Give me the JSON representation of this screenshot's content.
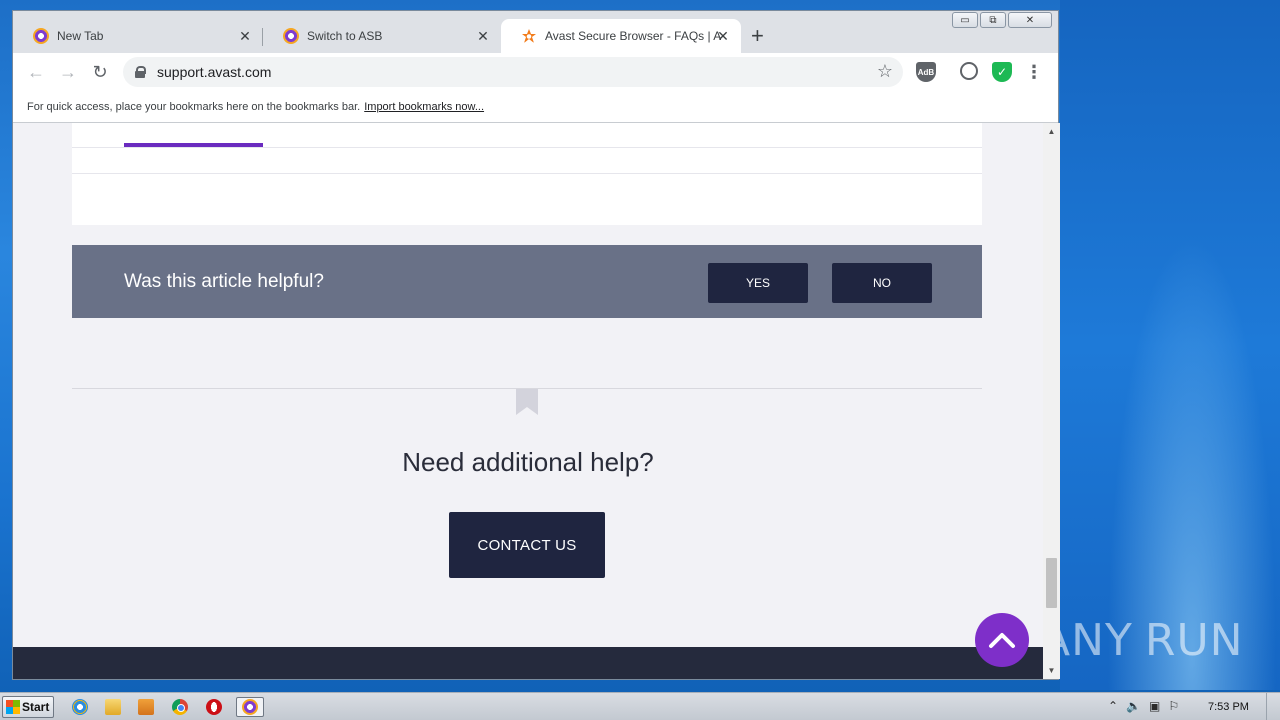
{
  "browser": {
    "tabs": [
      {
        "title": "New Tab",
        "close": "✕",
        "active": false
      },
      {
        "title": "Switch to ASB",
        "close": "✕",
        "active": false
      },
      {
        "title": "Avast Secure Browser - FAQs | Avast",
        "close": "✕",
        "active": true
      }
    ],
    "new_tab": "+",
    "url": "support.avast.com",
    "nav": {
      "back": "←",
      "forward": "→",
      "reload": "↻"
    },
    "star": "☆",
    "ext_shield_label": "AdB",
    "menu": "⋮",
    "bookmarks_bar": {
      "text": "For quick access, place your bookmarks here on the bookmarks bar.",
      "link": "Import bookmarks now..."
    },
    "window_controls": {
      "minimize": "▭",
      "restore": "⧉",
      "close": "✕"
    }
  },
  "page": {
    "helpful": {
      "question": "Was this article helpful?",
      "yes": "YES",
      "no": "NO"
    },
    "need_help": "Need additional help?",
    "contact": "CONTACT US"
  },
  "taskbar": {
    "start": "Start",
    "clock": "7:53 PM",
    "apps": [
      "internet-explorer-icon",
      "file-explorer-icon",
      "media-player-icon",
      "chrome-icon",
      "opera-icon",
      "avast-browser-icon"
    ]
  },
  "watermark": {
    "text_left": "ANY",
    "text_right": "RUN"
  },
  "colors": {
    "accent_purple": "#7e2fc9",
    "dark_navy": "#1f2540",
    "helpful_bar": "#697187",
    "footer": "#252a3d"
  }
}
